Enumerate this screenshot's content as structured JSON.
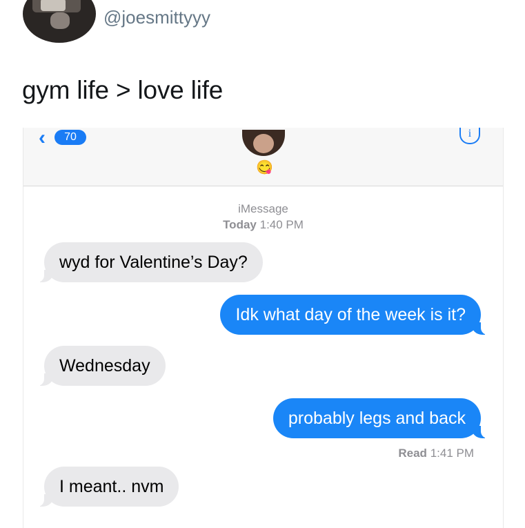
{
  "tweet": {
    "handle": "@joesmittyyy",
    "text": "gym life > love life"
  },
  "imessage": {
    "back_count": "70",
    "contact_emoji": "😋",
    "info_label": "i",
    "service_label": "iMessage",
    "timestamp_day": "Today",
    "timestamp_time": "1:40 PM",
    "messages": [
      {
        "from": "them",
        "text": "wyd for Valentine’s Day?"
      },
      {
        "from": "me",
        "text": "Idk what day of the week is it?"
      },
      {
        "from": "them",
        "text": "Wednesday"
      },
      {
        "from": "me",
        "text": "probably legs and back"
      },
      {
        "from": "them",
        "text": "I meant.. nvm"
      }
    ],
    "read_label": "Read",
    "read_time": "1:41 PM"
  },
  "colors": {
    "ios_blue": "#1a86f7",
    "received_bubble": "#e9e9eb",
    "meta_gray": "#8e8e93"
  }
}
